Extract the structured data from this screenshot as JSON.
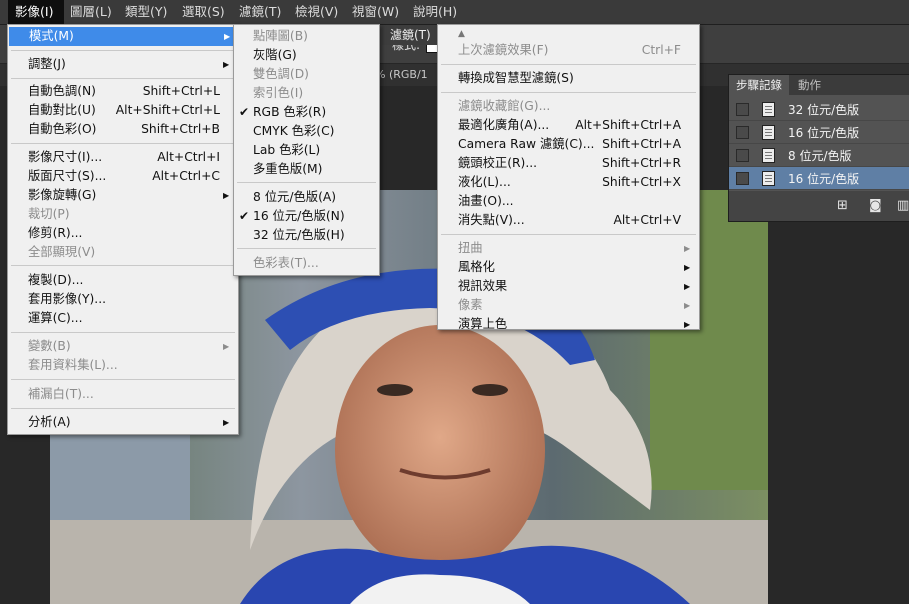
{
  "menubar": [
    {
      "label": "影像(I)",
      "active": true
    },
    {
      "label": "圖層(L)"
    },
    {
      "label": "類型(Y)"
    },
    {
      "label": "選取(S)"
    },
    {
      "label": "濾鏡(T)"
    },
    {
      "label": "檢視(V)"
    },
    {
      "label": "視窗(W)"
    },
    {
      "label": "說明(H)"
    }
  ],
  "optbar": {
    "style_label": "樣式:"
  },
  "tabstrip": {
    "doc_text": "0% (RGB/1"
  },
  "filter_header": "濾鏡(T)",
  "image_menu": [
    {
      "label": "模式(M)",
      "highlight": true,
      "submenu": true
    },
    {
      "label": "調整(J)",
      "submenu": true
    },
    {
      "label": "自動色調(N)",
      "shortcut": "Shift+Ctrl+L"
    },
    {
      "label": "自動對比(U)",
      "shortcut": "Alt+Shift+Ctrl+L"
    },
    {
      "label": "自動色彩(O)",
      "shortcut": "Shift+Ctrl+B"
    },
    {
      "label": "影像尺寸(I)...",
      "shortcut": "Alt+Ctrl+I"
    },
    {
      "label": "版面尺寸(S)...",
      "shortcut": "Alt+Ctrl+C"
    },
    {
      "label": "影像旋轉(G)",
      "submenu": true
    },
    {
      "label": "裁切(P)",
      "disabled": true
    },
    {
      "label": "修剪(R)..."
    },
    {
      "label": "全部顯現(V)",
      "disabled": true
    },
    {
      "label": "複製(D)..."
    },
    {
      "label": "套用影像(Y)..."
    },
    {
      "label": "運算(C)..."
    },
    {
      "label": "變數(B)",
      "disabled": true,
      "submenu": true
    },
    {
      "label": "套用資料集(L)...",
      "disabled": true
    },
    {
      "label": "補漏白(T)...",
      "disabled": true
    },
    {
      "label": "分析(A)",
      "submenu": true
    }
  ],
  "mode_menu": [
    {
      "label": "點陣圖(B)",
      "disabled": true
    },
    {
      "label": "灰階(G)"
    },
    {
      "label": "雙色調(D)",
      "disabled": true
    },
    {
      "label": "索引色(I)",
      "disabled": true
    },
    {
      "label": "RGB 色彩(R)",
      "checked": true
    },
    {
      "label": "CMYK 色彩(C)"
    },
    {
      "label": "Lab 色彩(L)"
    },
    {
      "label": "多重色版(M)"
    },
    {
      "label": "8 位元/色版(A)"
    },
    {
      "label": "16 位元/色版(N)",
      "checked": true
    },
    {
      "label": "32 位元/色版(H)"
    },
    {
      "label": "色彩表(T)...",
      "disabled": true
    }
  ],
  "filter_menu": [
    {
      "label": "上次濾鏡效果(F)",
      "shortcut": "Ctrl+F",
      "disabled": true
    },
    {
      "label": "轉換成智慧型濾鏡(S)"
    },
    {
      "label": "濾鏡收藏館(G)...",
      "disabled": true
    },
    {
      "label": "最適化廣角(A)...",
      "shortcut": "Alt+Shift+Ctrl+A"
    },
    {
      "label": "Camera Raw 濾鏡(C)...",
      "shortcut": "Shift+Ctrl+A"
    },
    {
      "label": "鏡頭校正(R)...",
      "shortcut": "Shift+Ctrl+R"
    },
    {
      "label": "液化(L)...",
      "shortcut": "Shift+Ctrl+X"
    },
    {
      "label": "油畫(O)..."
    },
    {
      "label": "消失點(V)...",
      "shortcut": "Alt+Ctrl+V"
    },
    {
      "label": "扭曲",
      "disabled": true,
      "submenu": true
    },
    {
      "label": "風格化",
      "submenu": true
    },
    {
      "label": "視訊效果",
      "submenu": true
    },
    {
      "label": "像素",
      "disabled": true,
      "submenu": true
    },
    {
      "label": "演算上色",
      "submenu": true
    }
  ],
  "history_panel": {
    "tabs": [
      "步驟記錄",
      "動作"
    ],
    "items": [
      {
        "label": "32 位元/色版"
      },
      {
        "label": "16 位元/色版"
      },
      {
        "label": "8 位元/色版"
      },
      {
        "label": "16 位元/色版",
        "selected": true
      }
    ]
  },
  "colors": {
    "menu_highlight": "#3f8be9",
    "history_selected": "#5f7fa5"
  }
}
